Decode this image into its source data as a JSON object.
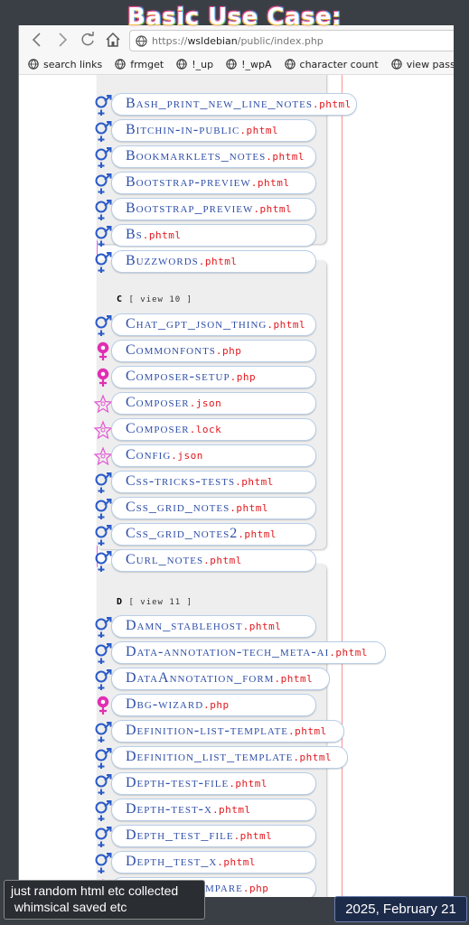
{
  "overlay": {
    "title": "Basic Use Case:",
    "note_line1": "just random html etc collected",
    "note_line2": " whimsical saved etc",
    "date": "2025, February 21"
  },
  "browser": {
    "url_scheme": "https://",
    "url_host": "wsldebian",
    "url_path": "/public/index.php",
    "bookmarks": [
      "search links",
      "frmget",
      "!_up",
      "!_wpA",
      "character count",
      "view password"
    ]
  },
  "colors": {
    "male_female_symbol": "#2a5bc8",
    "female_symbol": "#e02fb4",
    "star_symbol": "#e457d4",
    "filename": "#2f4fa8",
    "extension": "#e0181e",
    "guide_pink": "#e060e0",
    "guide_red": "#ff9090"
  },
  "sections": [
    {
      "letter": "C",
      "label": "[ view 10 ]"
    },
    {
      "letter": "D",
      "label": "[ view 11 ]"
    }
  ],
  "files": [
    {
      "name": "Bash_print_new_line_notes",
      "ext": ".phtml",
      "icon": "male-female-icon"
    },
    {
      "name": "Bitchin-in-public",
      "ext": ".phtml",
      "icon": "male-female-icon"
    },
    {
      "name": "Bookmarklets_notes",
      "ext": ".phtml",
      "icon": "male-female-icon"
    },
    {
      "name": "Bootstrap-preview",
      "ext": ".phtml",
      "icon": "male-female-icon"
    },
    {
      "name": "Bootstrap_preview",
      "ext": ".phtml",
      "icon": "male-female-icon"
    },
    {
      "name": "Bs",
      "ext": ".phtml",
      "icon": "male-female-icon"
    },
    {
      "name": "Buzzwords",
      "ext": ".phtml",
      "icon": "male-female-icon"
    },
    {
      "name": "Chat_gpt_json_thing",
      "ext": ".phtml",
      "icon": "male-female-icon"
    },
    {
      "name": "Commonfonts",
      "ext": ".php",
      "icon": "female-icon"
    },
    {
      "name": "Composer-setup",
      "ext": ".php",
      "icon": "female-icon"
    },
    {
      "name": "Composer",
      "ext": ".json",
      "icon": "star-icon"
    },
    {
      "name": "Composer",
      "ext": ".lock",
      "icon": "star-icon"
    },
    {
      "name": "Config",
      "ext": ".json",
      "icon": "star-icon"
    },
    {
      "name": "Css-tricks-tests",
      "ext": ".phtml",
      "icon": "male-female-icon"
    },
    {
      "name": "Css_grid_notes",
      "ext": ".phtml",
      "icon": "male-female-icon"
    },
    {
      "name": "Css_grid_notes2",
      "ext": ".phtml",
      "icon": "male-female-icon"
    },
    {
      "name": "Curl_notes",
      "ext": ".phtml",
      "icon": "male-female-icon"
    },
    {
      "name": "Damn_stablehost",
      "ext": ".phtml",
      "icon": "male-female-icon"
    },
    {
      "name": "Data-annotation-tech_meta-ai",
      "ext": ".phtml",
      "icon": "male-female-icon"
    },
    {
      "name": "DataAnnotation_form",
      "ext": ".phtml",
      "icon": "male-female-icon"
    },
    {
      "name": "Dbg-wizard",
      "ext": ".php",
      "icon": "female-icon"
    },
    {
      "name": "Definition-list-template",
      "ext": ".phtml",
      "icon": "male-female-icon"
    },
    {
      "name": "Definition_list_template",
      "ext": ".phtml",
      "icon": "male-female-icon"
    },
    {
      "name": "Depth-test-file",
      "ext": ".phtml",
      "icon": "male-female-icon"
    },
    {
      "name": "Depth-test-x",
      "ext": ".phtml",
      "icon": "male-female-icon"
    },
    {
      "name": "Depth_test_file",
      "ext": ".phtml",
      "icon": "male-female-icon"
    },
    {
      "name": "Depth_test_x",
      "ext": ".phtml",
      "icon": "male-female-icon"
    },
    {
      "name": "Dochead-compare",
      "ext": ".php",
      "icon": "female-icon"
    }
  ]
}
